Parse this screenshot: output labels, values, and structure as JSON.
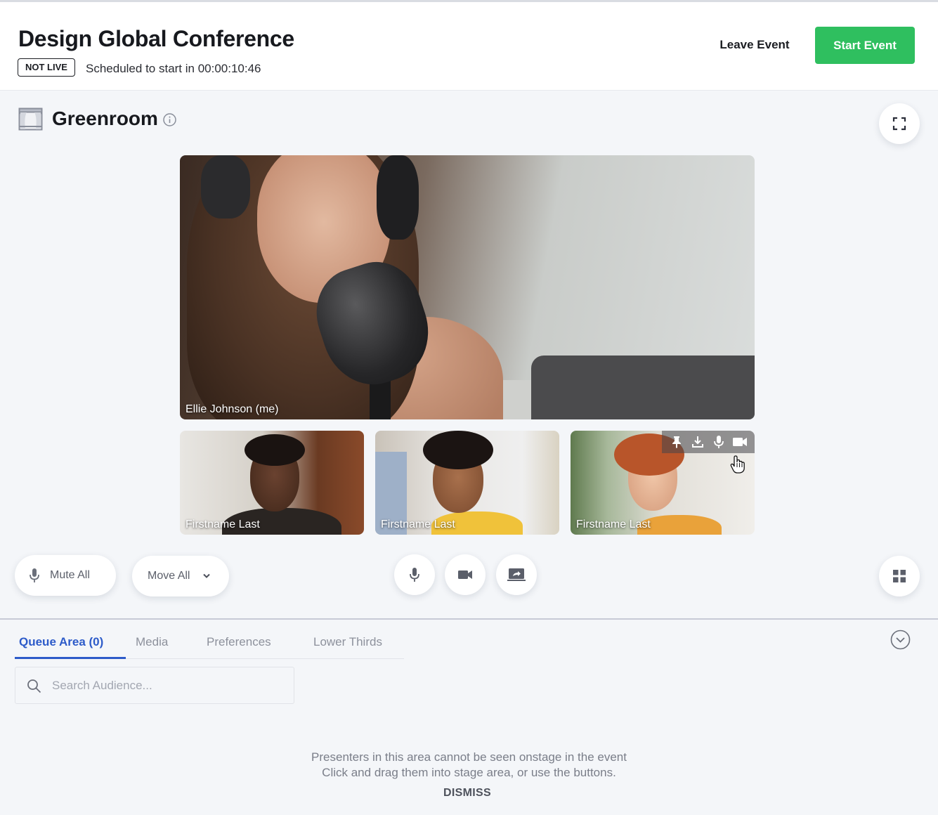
{
  "header": {
    "title": "Design Global Conference",
    "status_badge": "NOT LIVE",
    "schedule": "Scheduled to start in 00:00:10:46",
    "leave_label": "Leave Event",
    "start_label": "Start Event",
    "start_color": "#2fbf5f"
  },
  "room": {
    "title": "Greenroom",
    "icon": "stage-icon"
  },
  "stage": {
    "main_participant": "Ellie Johnson (me)",
    "participants": [
      {
        "name": "Firstname Last"
      },
      {
        "name": "Firstname Last"
      },
      {
        "name": "Firstname Last"
      }
    ],
    "tile_toolbar_icons": [
      "pin-icon",
      "download-icon",
      "mic-icon",
      "camera-icon"
    ]
  },
  "controls": {
    "mute_all_label": "Mute All",
    "move_all_label": "Move All"
  },
  "panel": {
    "tabs": [
      {
        "label": "Queue Area (0)"
      },
      {
        "label": "Media"
      },
      {
        "label": "Preferences"
      },
      {
        "label": "Lower Thirds"
      }
    ],
    "accent_color": "#2d5bc9",
    "search_placeholder": "Search Audience...",
    "notice_line1": "Presenters in this area cannot be seen onstage in the event",
    "notice_line2": "Click and drag them into stage area, or use the buttons.",
    "dismiss_label": "DISMISS"
  }
}
